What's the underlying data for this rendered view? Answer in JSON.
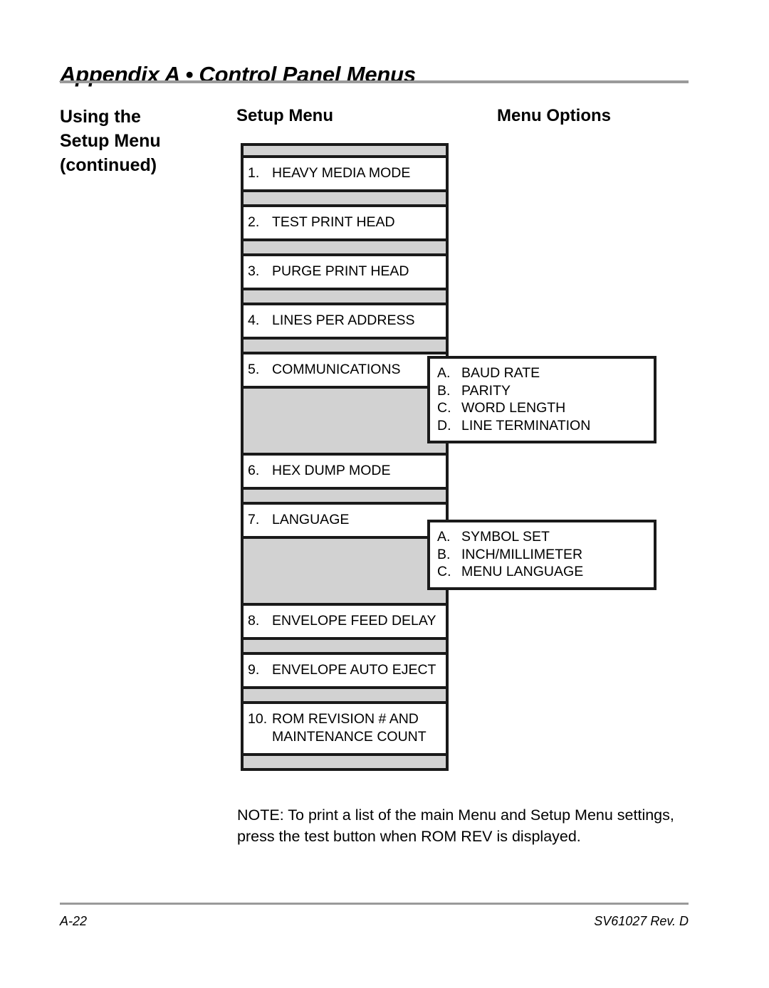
{
  "header": {
    "title": "Appendix A • Control Panel Menus"
  },
  "sidebar": {
    "line1": "Using the",
    "line2": "Setup Menu",
    "line3": "(continued)"
  },
  "columns": {
    "setup_heading": "Setup Menu",
    "options_heading": "Menu Options"
  },
  "menu": {
    "items": [
      {
        "num": "1.",
        "label": "HEAVY MEDIA MODE",
        "label2": ""
      },
      {
        "num": "2.",
        "label": "TEST PRINT HEAD",
        "label2": ""
      },
      {
        "num": "3.",
        "label": "PURGE PRINT HEAD",
        "label2": ""
      },
      {
        "num": "4.",
        "label": "LINES PER ADDRESS",
        "label2": ""
      },
      {
        "num": "5.",
        "label": "COMMUNICATIONS",
        "label2": ""
      },
      {
        "num": "6.",
        "label": "HEX DUMP MODE",
        "label2": ""
      },
      {
        "num": "7.",
        "label": "LANGUAGE",
        "label2": ""
      },
      {
        "num": "8.",
        "label": "ENVELOPE FEED DELAY",
        "label2": ""
      },
      {
        "num": "9.",
        "label": "ENVELOPE AUTO EJECT",
        "label2": ""
      },
      {
        "num": "10.",
        "label": "ROM REVISION # AND",
        "label2": "MAINTENANCE COUNT"
      }
    ]
  },
  "submenus": {
    "communications": {
      "parent": "COMMUNICATIONS",
      "options": [
        {
          "letter": "A.",
          "label": "BAUD RATE"
        },
        {
          "letter": "B.",
          "label": "PARITY"
        },
        {
          "letter": "C.",
          "label": "WORD LENGTH"
        },
        {
          "letter": "D.",
          "label": "LINE TERMINATION"
        }
      ]
    },
    "language": {
      "parent": "LANGUAGE",
      "options": [
        {
          "letter": "A.",
          "label": "SYMBOL SET"
        },
        {
          "letter": "B.",
          "label": "INCH/MILLIMETER"
        },
        {
          "letter": "C.",
          "label": "MENU LANGUAGE"
        }
      ]
    }
  },
  "note": {
    "text": "NOTE: To print a list of the main Menu and Setup Menu settings, press the test button when ROM REV is displayed."
  },
  "footer": {
    "page_number": "A-22",
    "document_id": "SV61027 Rev. D"
  },
  "colors": {
    "band_gray": "#d2d2d2",
    "rule_gray": "#9a9a9a",
    "border_black": "#1a1a1a"
  }
}
